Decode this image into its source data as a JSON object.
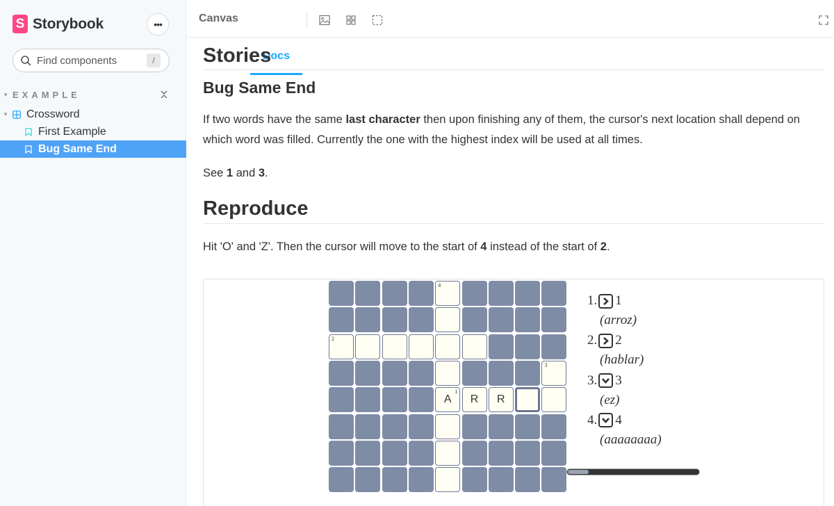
{
  "sidebar": {
    "brand": {
      "logo_letter": "S",
      "name": "Storybook"
    },
    "menu_label": "•••",
    "search": {
      "placeholder": "Find components",
      "shortcut": "/"
    },
    "group": {
      "title": "EXAMPLE"
    },
    "component": {
      "label": "Crossword"
    },
    "stories": [
      {
        "label": "First Example"
      },
      {
        "label": "Bug Same End"
      }
    ]
  },
  "toolbar": {
    "tabs": [
      {
        "label": "Canvas"
      },
      {
        "label": "Docs"
      }
    ],
    "icons": [
      "image-icon",
      "grid-icon",
      "outline-icon",
      "fullscreen-icon"
    ]
  },
  "docs": {
    "heading": "Stories",
    "story_title": "Bug Same End",
    "paragraph1": {
      "before": "If two words have the same ",
      "bold": "last character",
      "after": " then upon finishing any of them, the cursor's next location shall depend on which word was filled. Currently the one with the highest index will be used at all times."
    },
    "paragraph2": {
      "before": "See ",
      "bold1": "1",
      "middle": " and ",
      "bold2": "3",
      "after": "."
    },
    "reproduce_heading": "Reproduce",
    "paragraph3": {
      "before": "Hit 'O' and 'Z'. Then the cursor will move to the start of ",
      "bold1": "4",
      "middle": " instead of the start of ",
      "bold2": "2",
      "after": "."
    }
  },
  "crossword": {
    "colors": {
      "block": "#7f8ca6",
      "open": "#fffff3",
      "border": "#6b7792"
    },
    "rows": [
      "####O####",
      "####O####",
      "OOOOOO###",
      "####O###O",
      "####OOOOO",
      "####O####",
      "####O####",
      "####O####"
    ],
    "numbers": [
      {
        "row": 0,
        "col": 4,
        "n": "4"
      },
      {
        "row": 2,
        "col": 0,
        "n": "2"
      },
      {
        "row": 3,
        "col": 8,
        "n": "3"
      },
      {
        "row": 4,
        "col": 4,
        "n": "1"
      }
    ],
    "letters": [
      {
        "row": 4,
        "col": 4,
        "ch": "A"
      },
      {
        "row": 4,
        "col": 5,
        "ch": "R"
      },
      {
        "row": 4,
        "col": 6,
        "ch": "R"
      }
    ],
    "selected": {
      "row": 4,
      "col": 7
    },
    "clues": [
      {
        "prefix": "1.",
        "direction": "across",
        "number": "1",
        "answer": "(arroz)"
      },
      {
        "prefix": "2.",
        "direction": "across",
        "number": "2",
        "answer": "(hablar)"
      },
      {
        "prefix": "3.",
        "direction": "down",
        "number": "3",
        "answer": "(ez)"
      },
      {
        "prefix": "4.",
        "direction": "down",
        "number": "4",
        "answer": "(aaaaaaaa)"
      }
    ]
  }
}
